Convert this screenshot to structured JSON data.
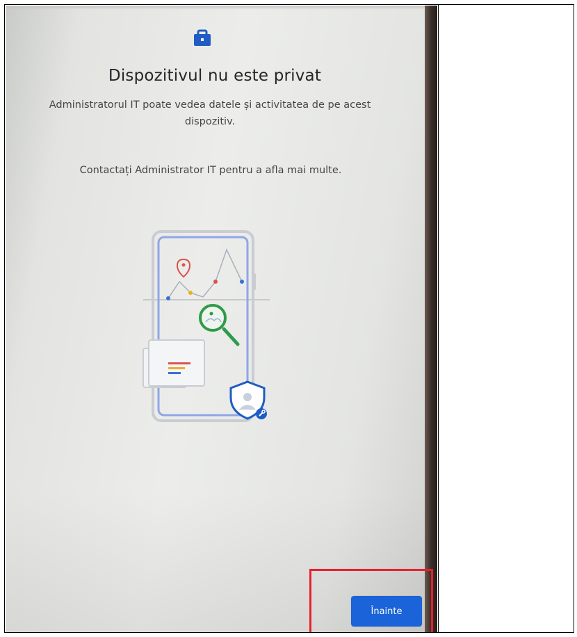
{
  "screen": {
    "title": "Dispozitivul nu este privat",
    "description_line1": "Administratorul IT poate vedea datele și activitatea de pe acest",
    "description_line2": "dispozitiv.",
    "contact": "Contactați Administrator IT pentru a afla mai multe."
  },
  "icons": {
    "header": "work-briefcase-icon",
    "illustration": "phone-monitoring-illustration",
    "shield": "shield-user-icon",
    "magnifier": "magnifier-icon"
  },
  "next_button": {
    "label": "Înainte"
  },
  "colors": {
    "accent": "#1a63d8",
    "highlight": "#e8202c",
    "text": "#262626"
  }
}
